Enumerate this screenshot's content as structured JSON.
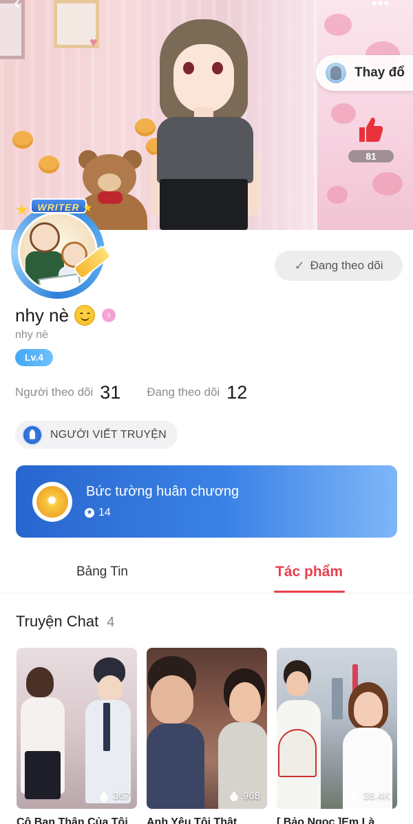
{
  "cover": {
    "change_label": "Thay đổ",
    "like_count": "81"
  },
  "avatar": {
    "badge": "WRITER"
  },
  "profile": {
    "follow_button": "Đang theo dõi",
    "name": "nhy nè",
    "gender_symbol": "♀",
    "username": "nhy nè",
    "level": "Lv.4",
    "followers_label": "Người theo dõi",
    "followers_count": "31",
    "following_label": "Đang theo dõi",
    "following_count": "12",
    "role": "NGƯỜI VIẾT TRUYỆN"
  },
  "medals": {
    "title": "Bức tường huân chương",
    "count": "14"
  },
  "tabs": [
    {
      "label": "Bảng Tin",
      "active": false
    },
    {
      "label": "Tác phẩm",
      "active": true
    }
  ],
  "section": {
    "name": "Truyện Chat",
    "count": "4"
  },
  "stories": [
    {
      "views": "367",
      "title": "Cô Bạn Thân Của Tôi"
    },
    {
      "views": "968",
      "title": "Anh Yêu Tôi Thật"
    },
    {
      "views": "38.4K",
      "title": "[ Bảo Ngọc ]Em Là"
    }
  ],
  "colors": {
    "accent": "#e83f4d",
    "medal_card": "#2866cf",
    "level_badge": "#44a8f5"
  },
  "icons": {
    "back": "back-arrow-icon",
    "more": "more-dots-icon",
    "like": "thumbs-up-icon",
    "check": "check-icon",
    "role": "pen-nib-icon",
    "medal": "medal-icon",
    "views": "fire-icon"
  }
}
